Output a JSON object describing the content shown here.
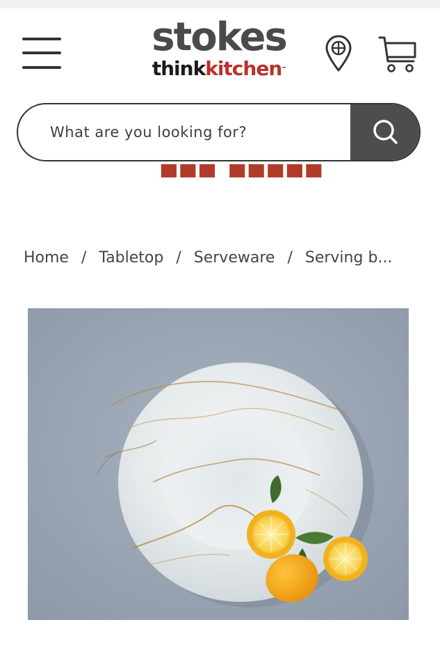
{
  "brand": {
    "name": "stokes",
    "sub_think": "think",
    "sub_kitchen": "kitchen",
    "trademark": "™"
  },
  "header": {
    "icons": [
      "hamburger-menu-icon",
      "location-pin-icon",
      "shopping-cart-icon"
    ]
  },
  "search": {
    "placeholder": "What are you looking for?",
    "icon": "search-icon"
  },
  "breadcrumb": {
    "items": [
      "Home",
      "Tabletop",
      "Serveware"
    ],
    "current": "Serving b...",
    "separator": "/"
  },
  "product": {
    "image": "marble-serving-bowl-with-lemons"
  },
  "colors": {
    "brand_gray": "#4a4a4a",
    "brand_red": "#b8322a",
    "search_button": "#4d4d4d",
    "text": "#444444",
    "backdrop": "#9aa5b4"
  }
}
